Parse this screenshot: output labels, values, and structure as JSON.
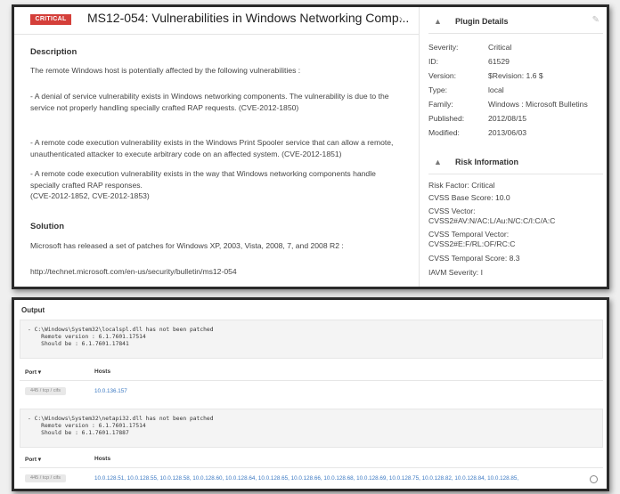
{
  "vulnerability": {
    "severity_badge": "CRITICAL",
    "title": "MS12-054: Vulnerabilities in Windows Networking Comp...",
    "description_heading": "Description",
    "description": [
      "The remote Windows host is potentially affected by the following vulnerabilities :",
      "- A denial of service vulnerability exists in Windows networking components. The vulnerability is due to the service not properly handling specially crafted RAP requests. (CVE-2012-1850)",
      "- A remote code execution vulnerability exists in the Windows Print Spooler service that can allow a remote, unauthenticated attacker to execute arbitrary code on an affected system. (CVE-2012-1851)",
      "- A remote code execution vulnerability exists in the way that Windows networking components handle specially crafted RAP responses.",
      "(CVE-2012-1852, CVE-2012-1853)"
    ],
    "solution_heading": "Solution",
    "solution": "Microsoft has released a set of patches for Windows XP, 2003, Vista, 2008, 7, and 2008 R2 :",
    "solution_link": "http://technet.microsoft.com/en-us/security/bulletin/ms12-054"
  },
  "plugin_details": {
    "heading": "Plugin Details",
    "rows": [
      {
        "key": "Severity:",
        "value": "Critical"
      },
      {
        "key": "ID:",
        "value": "61529"
      },
      {
        "key": "Version:",
        "value": "$Revision: 1.6 $"
      },
      {
        "key": "Type:",
        "value": "local"
      },
      {
        "key": "Family:",
        "value": "Windows : Microsoft Bulletins"
      },
      {
        "key": "Published:",
        "value": "2012/08/15"
      },
      {
        "key": "Modified:",
        "value": "2013/06/03"
      }
    ]
  },
  "risk_information": {
    "heading": "Risk Information",
    "risk_factor": "Risk Factor: Critical",
    "cvss_base": "CVSS Base Score: 10.0",
    "cvss_vector_label": "CVSS Vector:",
    "cvss_vector": "CVSS2#AV:N/AC:L/Au:N/C:C/I:C/A:C",
    "cvss_temporal_vector_label": "CVSS Temporal Vector:",
    "cvss_temporal_vector": "CVSS2#E:F/RL:OF/RC:C",
    "cvss_temporal_score": "CVSS Temporal Score: 8.3",
    "iavm_severity": "IAVM Severity: I"
  },
  "output": {
    "label": "Output",
    "blocks": [
      {
        "code": "- C:\\Windows\\System32\\localspl.dll has not been patched\n    Remote version : 6.1.7601.17514\n    Should be : 6.1.7601.17841",
        "port_header": "Port ▾",
        "hosts_header": "Hosts",
        "port": "445 / tcp / cifs",
        "hosts": "10.0.136.157"
      },
      {
        "code": "- C:\\Windows\\System32\\netapi32.dll has not been patched\n    Remote version : 6.1.7601.17514\n    Should be : 6.1.7601.17887",
        "port_header": "Port ▾",
        "hosts_header": "Hosts",
        "port": "445 / tcp / cifs",
        "hosts": "10.0.128.51,  10.0.128.55,  10.0.128.58,  10.0.128.60,  10.0.128.64,  10.0.128.65,  10.0.128.66,  10.0.128.68,  10.0.128.69,  10.0.128.75,  10.0.128.82,  10.0.128.84,  10.0.128.85,"
      }
    ]
  },
  "icons": {
    "chevron": "chevron-right-icon",
    "collapse": "caret-up-icon",
    "edit": "pencil-icon",
    "more": "circle-icon"
  },
  "colors": {
    "critical": "#d43f3a",
    "link": "#3a78c2"
  }
}
